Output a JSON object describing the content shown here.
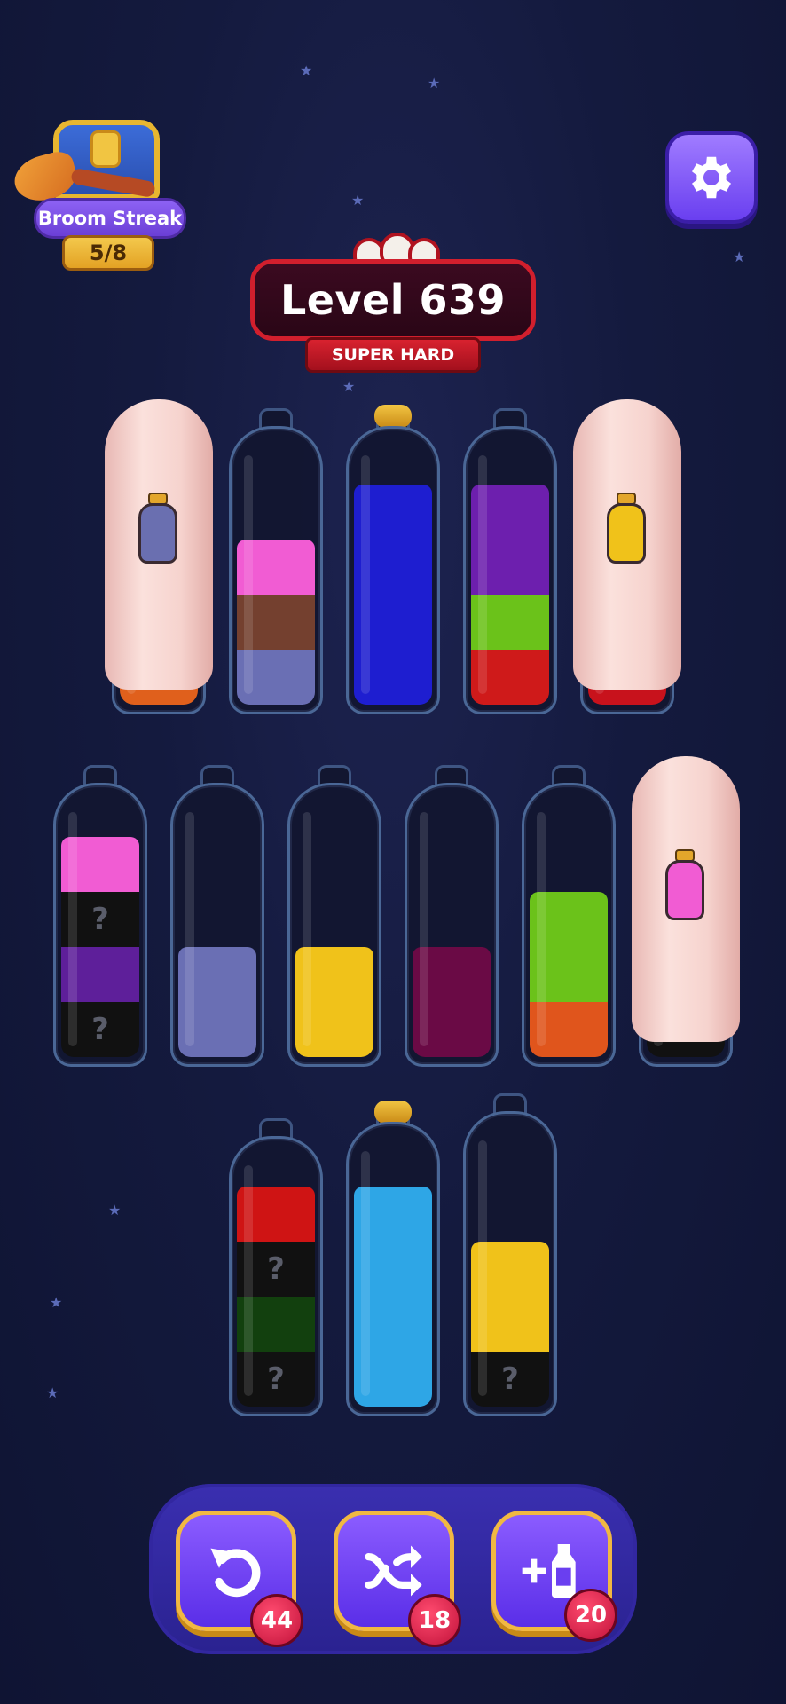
{
  "streak": {
    "label": "Broom Streak",
    "count": "5/8"
  },
  "level": {
    "title": "Level 639",
    "difficulty": "SUPER HARD"
  },
  "bottles": [
    {
      "row": 1,
      "col": 1,
      "hidden": true,
      "mini_color": "#6a6fb0",
      "base_color": "#e0601c",
      "cap": false,
      "segments": []
    },
    {
      "row": 1,
      "col": 2,
      "hidden": false,
      "cap": false,
      "segments": [
        {
          "color": "#6a6fb4",
          "unknown": false
        },
        {
          "color": "#74402f",
          "unknown": false
        },
        {
          "color": "#f15cd3",
          "unknown": false
        }
      ]
    },
    {
      "row": 1,
      "col": 3,
      "hidden": false,
      "cap": true,
      "segments": [
        {
          "color": "#1e1ed0",
          "unknown": false
        },
        {
          "color": "#1e1ed0",
          "unknown": false
        },
        {
          "color": "#1e1ed0",
          "unknown": false
        },
        {
          "color": "#1e1ed0",
          "unknown": false
        }
      ]
    },
    {
      "row": 1,
      "col": 4,
      "hidden": false,
      "cap": false,
      "segments": [
        {
          "color": "#cf1a1a",
          "unknown": false
        },
        {
          "color": "#6bc21a",
          "unknown": false
        },
        {
          "color": "#6d1fae",
          "unknown": false
        },
        {
          "color": "#6d1fae",
          "unknown": false
        }
      ]
    },
    {
      "row": 1,
      "col": 5,
      "hidden": true,
      "mini_color": "#f0c21a",
      "base_color": "#c8121c",
      "cap": false,
      "segments": []
    },
    {
      "row": 2,
      "col": 1,
      "hidden": false,
      "cap": false,
      "segments": [
        {
          "color": "#111",
          "unknown": true,
          "label": "?"
        },
        {
          "color": "#5e1f9a",
          "unknown": false
        },
        {
          "color": "#111",
          "unknown": true,
          "label": "?"
        },
        {
          "color": "#f15cd3",
          "unknown": false
        }
      ]
    },
    {
      "row": 2,
      "col": 2,
      "hidden": false,
      "cap": false,
      "segments": [
        {
          "color": "#6a6fb4",
          "unknown": false
        },
        {
          "color": "#6a6fb4",
          "unknown": false
        }
      ]
    },
    {
      "row": 2,
      "col": 3,
      "hidden": false,
      "cap": false,
      "segments": [
        {
          "color": "#f0c21a",
          "unknown": false
        },
        {
          "color": "#f0c21a",
          "unknown": false
        }
      ]
    },
    {
      "row": 2,
      "col": 4,
      "hidden": false,
      "cap": false,
      "segments": [
        {
          "color": "#6a0a45",
          "unknown": false
        },
        {
          "color": "#6a0a45",
          "unknown": false
        }
      ]
    },
    {
      "row": 2,
      "col": 5,
      "hidden": false,
      "cap": false,
      "segments": [
        {
          "color": "#e0551c",
          "unknown": false
        },
        {
          "color": "#6bc21a",
          "unknown": false
        },
        {
          "color": "#6bc21a",
          "unknown": false
        }
      ]
    },
    {
      "row": 2,
      "col": 6,
      "hidden": true,
      "mini_color": "#f15cd3",
      "base_color": "#111",
      "cap": false,
      "segments": []
    },
    {
      "row": 3,
      "col": 1,
      "hidden": false,
      "cap": false,
      "segments": [
        {
          "color": "#111",
          "unknown": true,
          "label": "?"
        },
        {
          "color": "#12400e",
          "unknown": false
        },
        {
          "color": "#111",
          "unknown": true,
          "label": "?"
        },
        {
          "color": "#cf1414",
          "unknown": false
        }
      ]
    },
    {
      "row": 3,
      "col": 2,
      "hidden": false,
      "cap": true,
      "segments": [
        {
          "color": "#2ea6e6",
          "unknown": false
        },
        {
          "color": "#2ea6e6",
          "unknown": false
        },
        {
          "color": "#2ea6e6",
          "unknown": false
        },
        {
          "color": "#2ea6e6",
          "unknown": false
        }
      ]
    },
    {
      "row": 3,
      "col": 3,
      "hidden": false,
      "cap": false,
      "segments": [
        {
          "color": "#111",
          "unknown": true,
          "label": "?"
        },
        {
          "color": "#f0c21a",
          "unknown": false
        },
        {
          "color": "#f0c21a",
          "unknown": false
        }
      ]
    }
  ],
  "tools": {
    "undo": {
      "count": "44"
    },
    "shuffle": {
      "count": "18"
    },
    "add_bottle": {
      "count": "20"
    }
  }
}
